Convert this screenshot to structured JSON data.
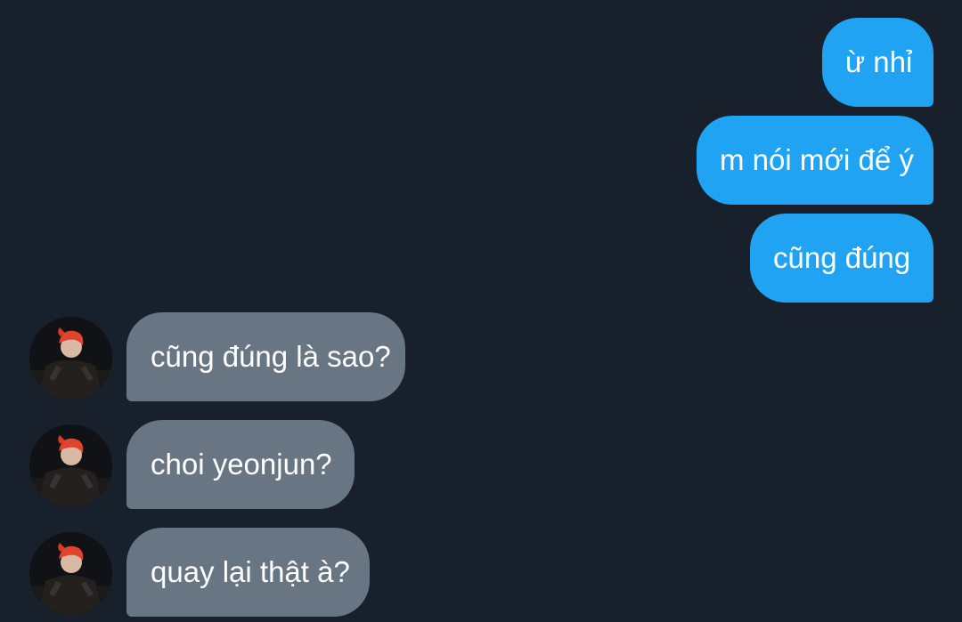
{
  "messages": {
    "sent": [
      {
        "text": "ừ nhỉ"
      },
      {
        "text": "m nói mới để ý"
      },
      {
        "text": "cũng đúng"
      }
    ],
    "received": [
      {
        "text": "cũng đúng là sao?"
      },
      {
        "text": "choi yeonjun?"
      },
      {
        "text": "quay lại thật à?"
      }
    ]
  },
  "colors": {
    "background": "#17202b",
    "sent_bubble": "#1fa3f2",
    "received_bubble": "#687684",
    "text": "#ffffff"
  },
  "icons": {
    "avatar": "profile-photo-avatar-icon"
  }
}
